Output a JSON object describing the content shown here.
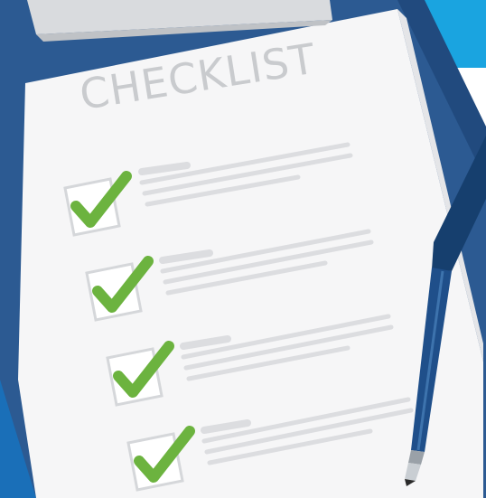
{
  "illustration": {
    "title": "CHECKLIST",
    "items_count": 4,
    "checkmark_icon": "checkmark-icon",
    "colors": {
      "check": "#6cb33f",
      "clipboard": "#2a5a94",
      "pen": "#1f4f8a",
      "accent": "#1aa4e0"
    }
  }
}
